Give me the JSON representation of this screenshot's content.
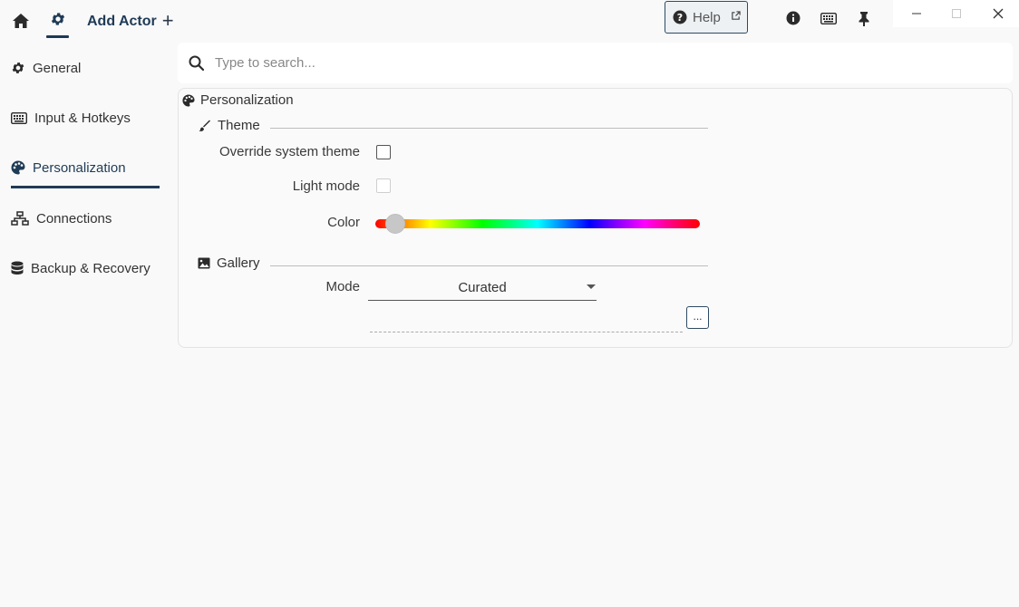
{
  "header": {
    "add_actor_label": "Add Actor",
    "add_symbol": "+",
    "help_label": "Help"
  },
  "sidebar": {
    "items": [
      {
        "label": "General",
        "icon": "gear-icon"
      },
      {
        "label": "Input & Hotkeys",
        "icon": "keyboard-icon"
      },
      {
        "label": "Personalization",
        "icon": "palette-icon",
        "active": true
      },
      {
        "label": "Connections",
        "icon": "network-icon"
      },
      {
        "label": "Backup & Recovery",
        "icon": "database-icon"
      }
    ]
  },
  "search": {
    "placeholder": "Type to search...",
    "value": ""
  },
  "personalization": {
    "title": "Personalization",
    "theme": {
      "title": "Theme",
      "override_label": "Override system theme",
      "override_checked": false,
      "light_mode_label": "Light mode",
      "light_mode_checked": false,
      "light_mode_enabled": false,
      "color_label": "Color",
      "color_hue_fraction": 0.03
    },
    "gallery": {
      "title": "Gallery",
      "mode_label": "Mode",
      "mode_value": "Curated",
      "path_value": "",
      "browse_label": "..."
    }
  },
  "colors": {
    "accent": "#1f3b56",
    "background": "#f9f9f9"
  }
}
